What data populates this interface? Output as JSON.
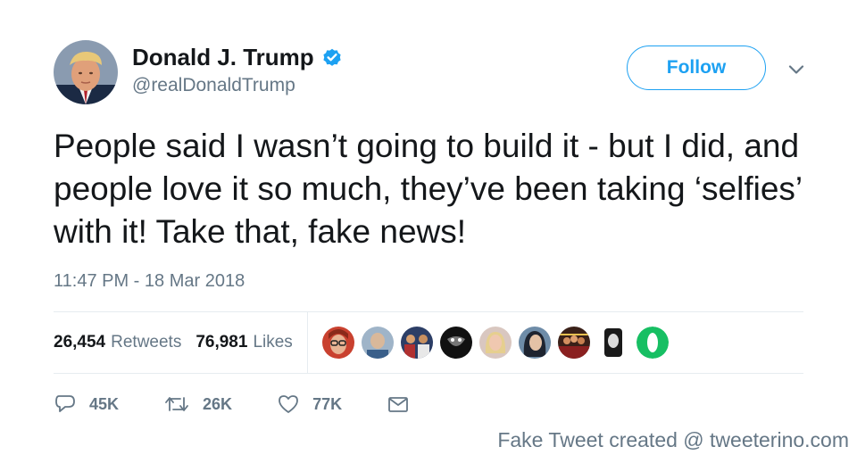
{
  "user": {
    "name": "Donald J. Trump",
    "handle": "@realDonaldTrump",
    "verified": true
  },
  "follow_button": {
    "label": "Follow"
  },
  "tweet": {
    "text": "People said I wasn’t going to build it - but I did, and people love it so much, they’ve been taking ‘selfies’ with it! Take that, fake news!",
    "timestamp": "11:47 PM - 18 Mar 2018"
  },
  "stats": {
    "retweets_count": "26,454",
    "retweets_label": "Retweets",
    "likes_count": "76,981",
    "likes_label": "Likes"
  },
  "liker_avatars": [
    "avatar-woman-glasses-red",
    "avatar-person-blue",
    "avatar-group-photo",
    "avatar-dark-symbol",
    "avatar-blonde-woman",
    "avatar-dark-hair-woman",
    "avatar-crowd-photo",
    "avatar-dark-portrait",
    "avatar-green-ring-logo"
  ],
  "actions": {
    "reply_count": "45K",
    "retweet_count": "26K",
    "like_count": "77K"
  },
  "icons": [
    "verified-badge-icon",
    "chevron-down-icon",
    "reply-icon",
    "retweet-icon",
    "heart-icon",
    "envelope-icon"
  ],
  "colors": {
    "accent": "#1da1f2",
    "text": "#14171a",
    "secondary_text": "#657786",
    "divider": "#e6ecf0"
  },
  "footer": {
    "watermark": "Fake Tweet created @ tweeterino.com"
  }
}
